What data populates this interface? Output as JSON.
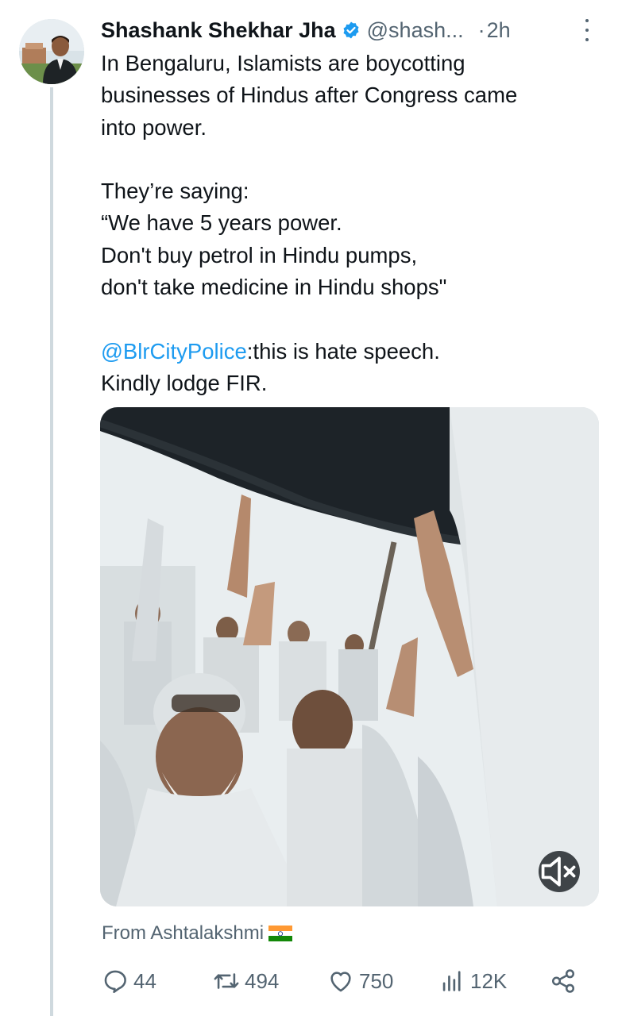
{
  "tweet": {
    "author_name": "Shashank Shekhar Jha",
    "author_handle": "@shash...",
    "separator": "·",
    "time": "2h",
    "text_lines": [
      "In Bengaluru, Islamists are boycotting",
      "businesses of Hindus after Congress came",
      "into power.",
      "They’re saying:",
      "“We have 5 years power.",
      "Don't buy petrol in Hindu pumps,",
      "don't take medicine in Hindu shops\""
    ],
    "mention": "@BlrCityPolice",
    "mention_suffix": ":this is hate speech.",
    "last_line": "Kindly lodge FIR."
  },
  "media": {
    "type": "video",
    "mute_icon": "speaker-muted-icon"
  },
  "source": {
    "label": "From Ashtalakshmi",
    "flag": "india-flag",
    "flag_colors": [
      "#ff9933",
      "#ffffff",
      "#138808"
    ]
  },
  "actions": {
    "replies": "44",
    "reposts": "494",
    "likes": "750",
    "views": "12K"
  },
  "colors": {
    "text": "#0f1419",
    "secondary": "#536471",
    "link": "#1d9bf0",
    "thread_line": "#cfd9de"
  }
}
